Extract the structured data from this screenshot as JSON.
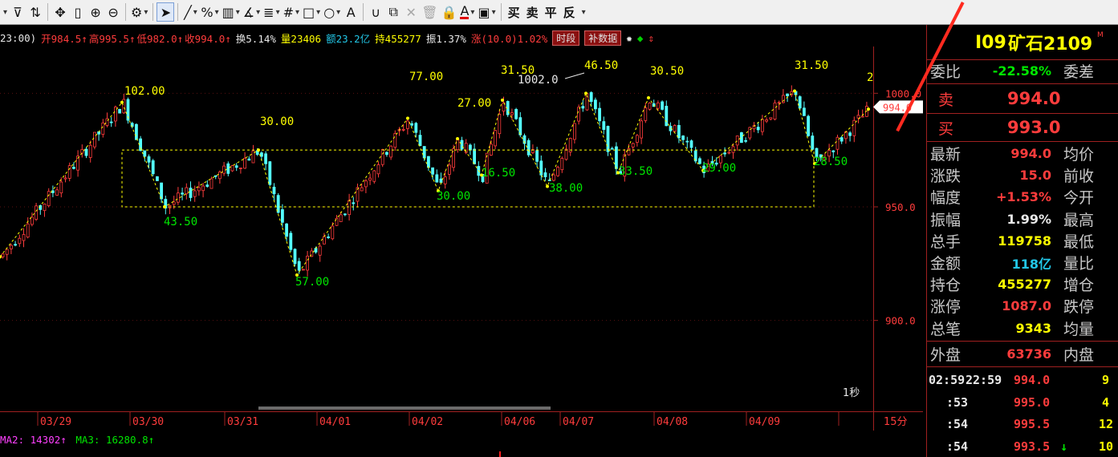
{
  "toolbar": {
    "tools": [
      "trend-line-tool",
      "percent-tool",
      "box-tool",
      "angle-tool",
      "parallel-tool",
      "grid-tool",
      "rect-tool",
      "circle-tool",
      "text-tool"
    ],
    "text_buttons": [
      "买",
      "卖",
      "平",
      "反"
    ]
  },
  "infoline": {
    "time": "23:00)",
    "open": "开984.5↑",
    "high": "高995.5↑",
    "low": "低982.0↑",
    "close": "收994.0↑",
    "turnover": "换5.14%",
    "volume": "量23406",
    "amount": "额23.2亿",
    "position": "持455277",
    "amplitude": "振1.37%",
    "change": "涨(10.0)1.02%",
    "btn_timeshare": "时段",
    "btn_supplement": "补数据"
  },
  "chart_data": {
    "type": "candlestick",
    "y_axis_ticks": [
      "1000.0",
      "950.0",
      "900.0"
    ],
    "ylim": [
      860,
      1010
    ],
    "last_price_tag": "994.0",
    "dates": [
      "03/29",
      "03/30",
      "03/31",
      "04/01",
      "04/02",
      "04/06",
      "04/07",
      "04/08",
      "04/09"
    ],
    "period_label": "15分",
    "time_step_label": "1秒",
    "annotation_high": "1002.0",
    "wave_labels_yellow": [
      "102.00",
      "30.00",
      "77.00",
      "27.00",
      "31.50",
      "46.50",
      "30.50",
      "31.50",
      "2"
    ],
    "wave_labels_green": [
      "43.50",
      "57.00",
      "30.00",
      "16.50",
      "38.00",
      "33.50",
      "29.00",
      "28.50"
    ]
  },
  "ma_bar": {
    "ma2": "MA2: 14302↑",
    "ma3": "MA3: 16280.8↑"
  },
  "panel": {
    "code": "I09",
    "name": "矿石2109",
    "weibi_label": "委比",
    "weibi_value": "-22.58%",
    "weicha_label": "委差",
    "sell_label": "卖",
    "sell_value": "994.0",
    "buy_label": "买",
    "buy_value": "993.0",
    "stats": [
      {
        "label": "最新",
        "value": "994.0",
        "color": "#ff3c3c",
        "label2": "均价"
      },
      {
        "label": "涨跌",
        "value": "15.0",
        "color": "#ff3c3c",
        "label2": "前收"
      },
      {
        "label": "幅度",
        "value": "+1.53%",
        "color": "#ff3c3c",
        "label2": "今开"
      },
      {
        "label": "振幅",
        "value": "1.99%",
        "color": "#e8e8e8",
        "label2": "最高"
      },
      {
        "label": "总手",
        "value": "119758",
        "color": "#ffff00",
        "label2": "最低"
      },
      {
        "label": "金额",
        "value": "118亿",
        "color": "#22c6e6",
        "label2": "量比"
      },
      {
        "label": "持仓",
        "value": "455277",
        "color": "#ffff00",
        "label2": "增仓"
      },
      {
        "label": "涨停",
        "value": "1087.0",
        "color": "#ff3c3c",
        "label2": "跌停"
      },
      {
        "label": "总笔",
        "value": "9343",
        "color": "#ffff00",
        "label2": "均量"
      }
    ],
    "outer_label": "外盘",
    "outer_value": "63736",
    "inner_label": "内盘",
    "ticks": [
      {
        "time": "02:59",
        "time2": "22:59",
        "price": "994.0",
        "arrow": "",
        "vol": "9"
      },
      {
        "time": ":53",
        "time2": "",
        "price": "995.0",
        "arrow": "",
        "vol": "4"
      },
      {
        "time": ":54",
        "time2": "",
        "price": "995.5",
        "arrow": "",
        "vol": "12"
      },
      {
        "time": ":54",
        "time2": "",
        "price": "993.5",
        "arrow": "↓",
        "vol": "10"
      }
    ]
  }
}
